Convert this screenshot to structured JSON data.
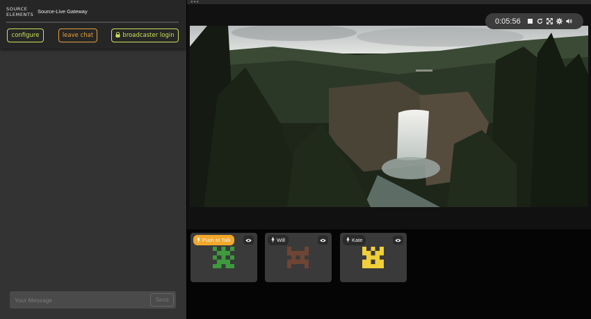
{
  "app": {
    "logo_line1": "SOURCE",
    "logo_line2": "ELEMENTS",
    "title": "Source-Live Gateway"
  },
  "header_buttons": {
    "configure": "configure",
    "leave_chat": "leave chat",
    "broadcaster_login": "broadcaster login"
  },
  "chat": {
    "placeholder": "Your Message",
    "send_label": "Send"
  },
  "player": {
    "elapsed": "0:05:56",
    "controls": [
      "stop-icon",
      "reload-icon",
      "fullscreen-icon",
      "settings-icon",
      "volume-icon"
    ]
  },
  "participants": [
    {
      "name": "Push to Talk",
      "icon": "microphone-icon",
      "avatar_color": "#3d9a3d",
      "chip_color": "#f3a82a"
    },
    {
      "name": "Will",
      "icon": "microphone-icon",
      "avatar_color": "#6e4535"
    },
    {
      "name": "Kate",
      "icon": "microphone-icon",
      "avatar_color": "#f0cf3a"
    }
  ],
  "colors": {
    "accent_green": "#cfe15a",
    "accent_orange": "#e8a23a",
    "sidebar_bg": "#333333"
  }
}
